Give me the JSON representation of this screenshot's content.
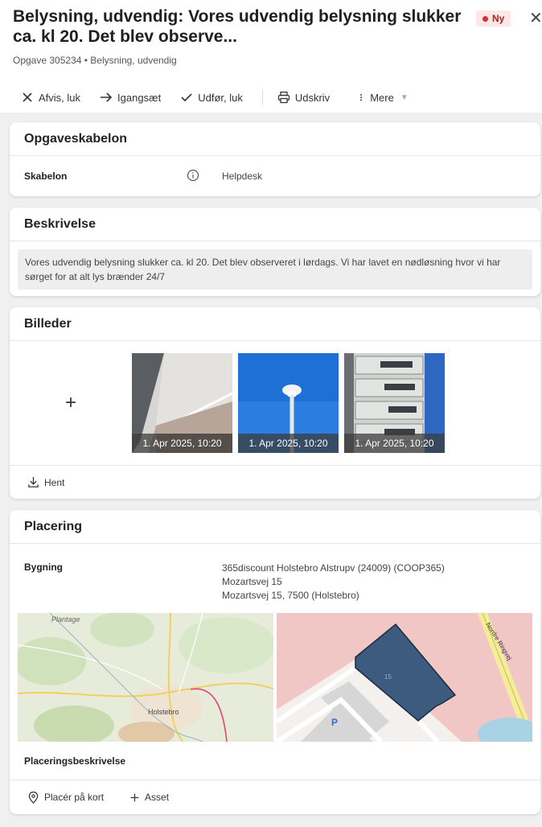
{
  "header": {
    "title": "Belysning, udvendig: Vores udvendig belysning slukker ca. kl 20. Det blev observe...",
    "badge": "Ny",
    "subtitle": "Opgave 305234 • Belysning, udvendig"
  },
  "toolbar": {
    "reject_label": "Afvis, luk",
    "start_label": "Igangsæt",
    "complete_label": "Udfør, luk",
    "print_label": "Udskriv",
    "more_label": "Mere"
  },
  "template_card": {
    "title": "Opgaveskabelon",
    "label": "Skabelon",
    "value": "Helpdesk"
  },
  "description_card": {
    "title": "Beskrivelse",
    "text": "Vores udvendig belysning slukker ca. kl 20. Det blev observeret i lørdags. Vi har lavet en nødløsning hvor vi har sørget for at alt lys brænder 24/7"
  },
  "images_card": {
    "title": "Billeder",
    "add_label": "+",
    "images": [
      {
        "caption": "1. Apr 2025, 10:20",
        "subject": "ceiling-light"
      },
      {
        "caption": "1. Apr 2025, 10:20",
        "subject": "street-lamp"
      },
      {
        "caption": "1. Apr 2025, 10:20",
        "subject": "electrical-panel"
      }
    ],
    "download_label": "Hent"
  },
  "placement_card": {
    "title": "Placering",
    "building_label": "Bygning",
    "address_lines": [
      "365discount Holstebro Alstrupv (24009) (COOP365)",
      "Mozartsvej 15",
      "Mozartsvej 15, 7500 (Holstebro)"
    ],
    "map_labels": {
      "town_top": "Plantage",
      "town": "Holstebro",
      "road": "Nordre Ringvej",
      "parking": "P",
      "building_number": "15"
    },
    "description_label": "Placeringsbeskrivelse",
    "place_on_map_label": "Placér på kort",
    "asset_label": "Asset"
  },
  "colors": {
    "badge_bg": "#fde7e9",
    "badge_dot": "#d32f2f",
    "building_fill": "#3d5a7f",
    "content_bg": "#f0f0f0"
  }
}
